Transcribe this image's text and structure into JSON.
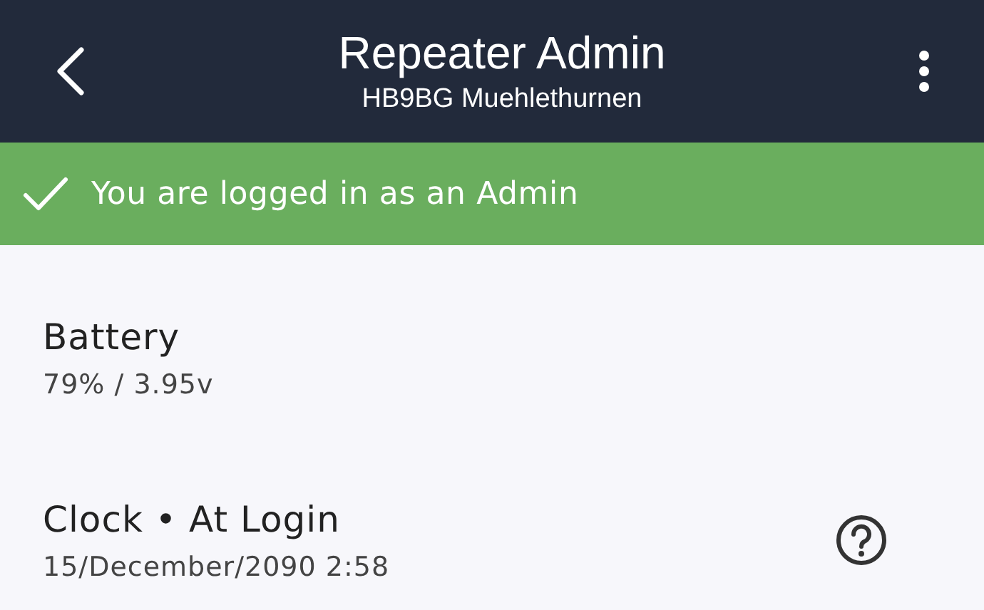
{
  "header": {
    "title": "Repeater Admin",
    "subtitle": "HB9BG Muehlethurnen"
  },
  "banner": {
    "text": "You are logged in as an Admin"
  },
  "items": [
    {
      "kind": "plain",
      "label": "Battery",
      "value": "79% / 3.95v"
    },
    {
      "kind": "help",
      "label": "Clock • At Login",
      "value": "15/December/2090 2:58"
    }
  ]
}
